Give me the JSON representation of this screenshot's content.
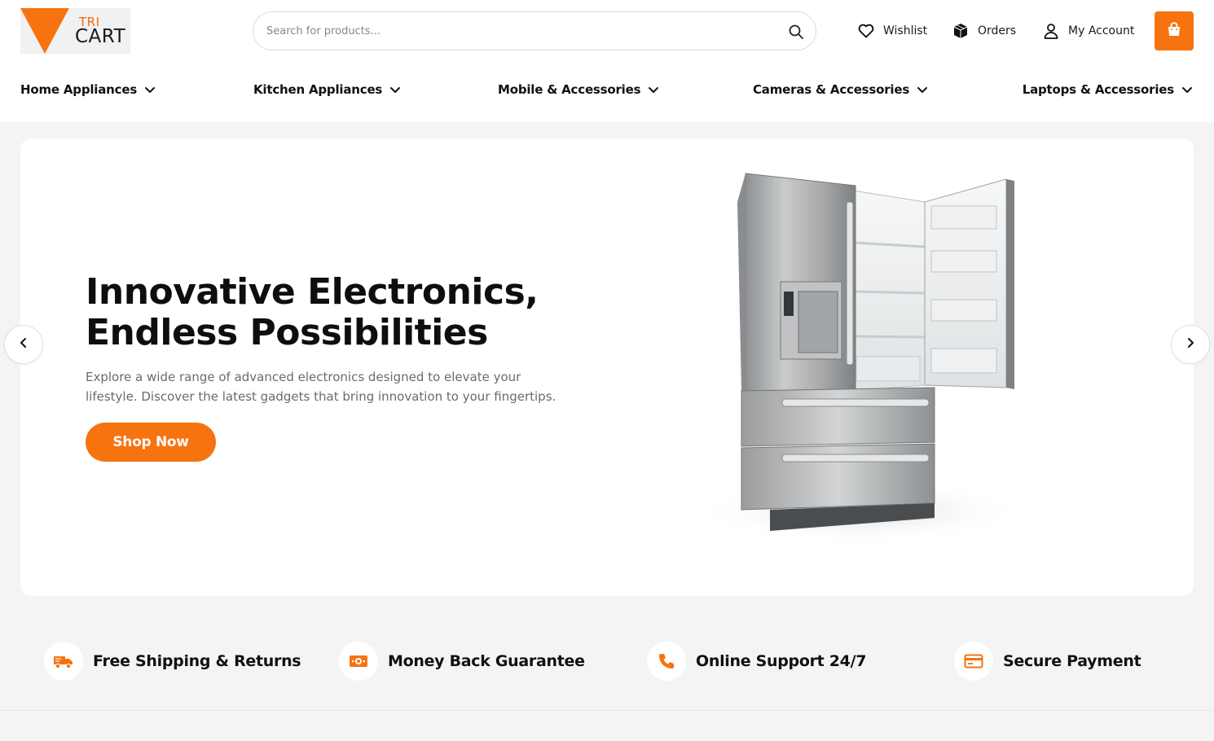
{
  "brand": {
    "top": "TRI",
    "bottom": "CART",
    "accent": "#f6730f"
  },
  "search": {
    "placeholder": "Search for products...",
    "value": ""
  },
  "header_links": {
    "wishlist": "Wishlist",
    "orders": "Orders",
    "account": "My Account"
  },
  "nav": [
    "Home Appliances",
    "Kitchen Appliances",
    "Mobile & Accessories",
    "Cameras & Accessories",
    "Laptops & Accessories"
  ],
  "hero": {
    "title_line1": "Innovative Electronics,",
    "title_line2": "Endless Possibilities",
    "description_line1": "Explore a wide range of advanced electronics designed to elevate your",
    "description_line2": "lifestyle. Discover the latest gadgets that bring innovation to your fingertips.",
    "cta": "Shop Now"
  },
  "features": [
    {
      "icon": "truck-icon",
      "label": "Free Shipping & Returns"
    },
    {
      "icon": "money-icon",
      "label": "Money Back Guarantee"
    },
    {
      "icon": "phone-icon",
      "label": "Online Support 24/7"
    },
    {
      "icon": "credit-card-icon",
      "label": "Secure Payment"
    }
  ]
}
